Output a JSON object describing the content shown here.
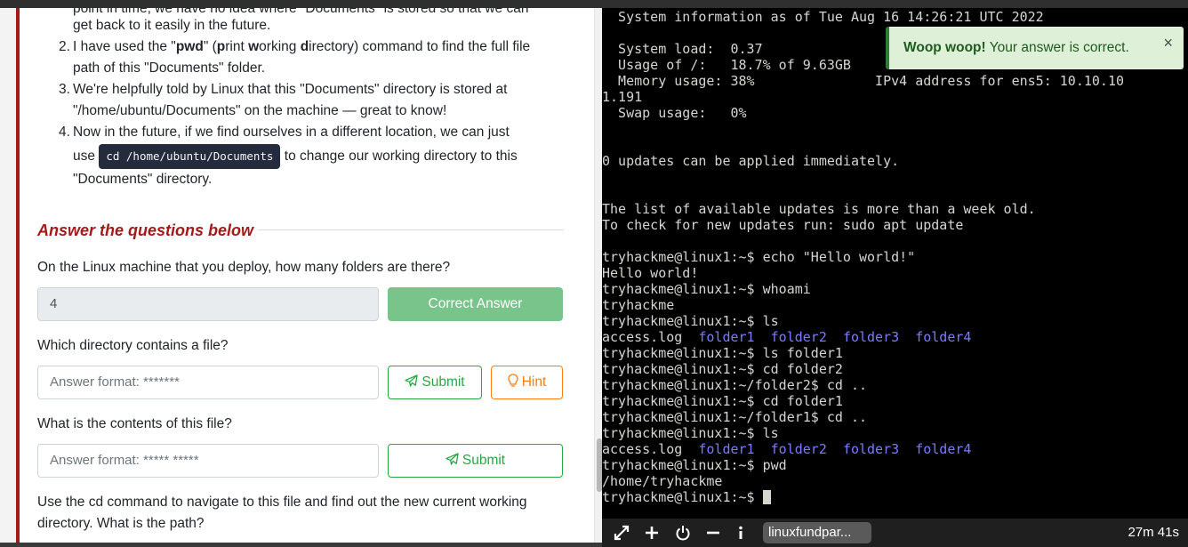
{
  "task": {
    "cut_line": "point in time, we have no idea where \"Documents\" is stored so that we can",
    "step1_tail": "get back to it easily in the future.",
    "step2_a": "I have used the \"",
    "step2_pwd": "pwd",
    "step2_b": "\" (",
    "step2_c": "rint ",
    "step2_d": "orking ",
    "step2_e": "irectory) command to find the full file",
    "step2_line2": "path of this \"Documents\" folder.",
    "step3_line1": "We're helpfully told by Linux that this \"Documents\" directory is stored at",
    "step3_line2": "\"/home/ubuntu/Documents\" on the machine — great to know!",
    "step4_line1": "Now in the future, if we find ourselves in a different location, we can just",
    "step4_use": "use",
    "step4_code": "cd /home/ubuntu/Documents",
    "step4_after": "to change our working directory to this",
    "step4_line3": "\"Documents\" directory.",
    "nums": [
      "2.",
      "3.",
      "4."
    ]
  },
  "answers": {
    "heading": "Answer the questions below",
    "q1": "On the Linux machine that you deploy, how many folders are there?",
    "q1_value": "4",
    "q1_button": "Correct Answer",
    "q2": "Which directory contains a file?",
    "q2_placeholder": "Answer format: *******",
    "q2_submit": "Submit",
    "q2_hint": "Hint",
    "q3": "What is the contents of this file?",
    "q3_placeholder": "Answer format: ***** *****",
    "q3_submit": "Submit",
    "q4_line1": "Use the cd command to navigate to this file and find out the new current working",
    "q4_line2": "directory. What is the path?"
  },
  "terminal": {
    "lines": [
      "  System information as of Tue Aug 16 14:26:21 UTC 2022",
      "",
      "  System load:  0.37",
      "  Usage of /:   18.7% of 9.63GB",
      "  Memory usage: 38%               IPv4 address for ens5: 10.10.10",
      "1.191",
      "  Swap usage:   0%",
      "",
      "",
      "0 updates can be applied immediately.",
      "",
      "",
      "The list of available updates is more than a week old.",
      "To check for new updates run: sudo apt update",
      "",
      "tryhackme@linux1:~$ echo \"Hello world!\"",
      "Hello world!",
      "tryhackme@linux1:~$ whoami",
      "tryhackme",
      "tryhackme@linux1:~$ ls",
      "",
      "tryhackme@linux1:~$ ls folder1",
      "tryhackme@linux1:~$ cd folder2",
      "tryhackme@linux1:~/folder2$ cd ..",
      "tryhackme@linux1:~$ cd folder1",
      "tryhackme@linux1:~/folder1$ cd ..",
      "tryhackme@linux1:~$ ls",
      "",
      "tryhackme@linux1:~$ pwd",
      "/home/tryhackme",
      "tryhackme@linux1:~$ "
    ],
    "ls_file": "access.log",
    "ls_folders": [
      "folder1",
      "folder2",
      "folder3",
      "folder4"
    ],
    "ls_color": "#7b7bff"
  },
  "toast": {
    "bold": "Woop woop!",
    "text": " Your answer is correct.",
    "close": "×"
  },
  "bottom_bar": {
    "tab_label": "linuxfundpar...",
    "timer": "27m 41s",
    "icons": [
      "expand-icon",
      "plus-icon",
      "power-icon",
      "minus-icon",
      "info-icon"
    ]
  },
  "colors": {
    "accent_red": "#a31a1a",
    "success_green": "#28a745",
    "correct_button": "#78c48a",
    "hint_orange": "#fd7e14"
  }
}
